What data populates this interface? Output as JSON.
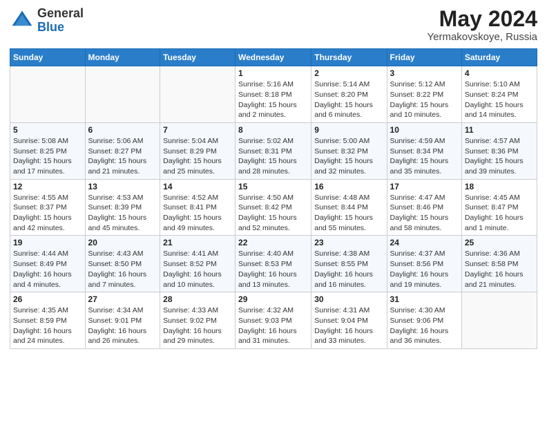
{
  "header": {
    "logo": {
      "general": "General",
      "blue": "Blue"
    },
    "title": "May 2024",
    "location": "Yermakovskoye, Russia"
  },
  "calendar": {
    "days_of_week": [
      "Sunday",
      "Monday",
      "Tuesday",
      "Wednesday",
      "Thursday",
      "Friday",
      "Saturday"
    ],
    "weeks": [
      [
        {
          "day": "",
          "info": ""
        },
        {
          "day": "",
          "info": ""
        },
        {
          "day": "",
          "info": ""
        },
        {
          "day": "1",
          "info": "Sunrise: 5:16 AM\nSunset: 8:18 PM\nDaylight: 15 hours\nand 2 minutes."
        },
        {
          "day": "2",
          "info": "Sunrise: 5:14 AM\nSunset: 8:20 PM\nDaylight: 15 hours\nand 6 minutes."
        },
        {
          "day": "3",
          "info": "Sunrise: 5:12 AM\nSunset: 8:22 PM\nDaylight: 15 hours\nand 10 minutes."
        },
        {
          "day": "4",
          "info": "Sunrise: 5:10 AM\nSunset: 8:24 PM\nDaylight: 15 hours\nand 14 minutes."
        }
      ],
      [
        {
          "day": "5",
          "info": "Sunrise: 5:08 AM\nSunset: 8:25 PM\nDaylight: 15 hours\nand 17 minutes."
        },
        {
          "day": "6",
          "info": "Sunrise: 5:06 AM\nSunset: 8:27 PM\nDaylight: 15 hours\nand 21 minutes."
        },
        {
          "day": "7",
          "info": "Sunrise: 5:04 AM\nSunset: 8:29 PM\nDaylight: 15 hours\nand 25 minutes."
        },
        {
          "day": "8",
          "info": "Sunrise: 5:02 AM\nSunset: 8:31 PM\nDaylight: 15 hours\nand 28 minutes."
        },
        {
          "day": "9",
          "info": "Sunrise: 5:00 AM\nSunset: 8:32 PM\nDaylight: 15 hours\nand 32 minutes."
        },
        {
          "day": "10",
          "info": "Sunrise: 4:59 AM\nSunset: 8:34 PM\nDaylight: 15 hours\nand 35 minutes."
        },
        {
          "day": "11",
          "info": "Sunrise: 4:57 AM\nSunset: 8:36 PM\nDaylight: 15 hours\nand 39 minutes."
        }
      ],
      [
        {
          "day": "12",
          "info": "Sunrise: 4:55 AM\nSunset: 8:37 PM\nDaylight: 15 hours\nand 42 minutes."
        },
        {
          "day": "13",
          "info": "Sunrise: 4:53 AM\nSunset: 8:39 PM\nDaylight: 15 hours\nand 45 minutes."
        },
        {
          "day": "14",
          "info": "Sunrise: 4:52 AM\nSunset: 8:41 PM\nDaylight: 15 hours\nand 49 minutes."
        },
        {
          "day": "15",
          "info": "Sunrise: 4:50 AM\nSunset: 8:42 PM\nDaylight: 15 hours\nand 52 minutes."
        },
        {
          "day": "16",
          "info": "Sunrise: 4:48 AM\nSunset: 8:44 PM\nDaylight: 15 hours\nand 55 minutes."
        },
        {
          "day": "17",
          "info": "Sunrise: 4:47 AM\nSunset: 8:46 PM\nDaylight: 15 hours\nand 58 minutes."
        },
        {
          "day": "18",
          "info": "Sunrise: 4:45 AM\nSunset: 8:47 PM\nDaylight: 16 hours\nand 1 minute."
        }
      ],
      [
        {
          "day": "19",
          "info": "Sunrise: 4:44 AM\nSunset: 8:49 PM\nDaylight: 16 hours\nand 4 minutes."
        },
        {
          "day": "20",
          "info": "Sunrise: 4:43 AM\nSunset: 8:50 PM\nDaylight: 16 hours\nand 7 minutes."
        },
        {
          "day": "21",
          "info": "Sunrise: 4:41 AM\nSunset: 8:52 PM\nDaylight: 16 hours\nand 10 minutes."
        },
        {
          "day": "22",
          "info": "Sunrise: 4:40 AM\nSunset: 8:53 PM\nDaylight: 16 hours\nand 13 minutes."
        },
        {
          "day": "23",
          "info": "Sunrise: 4:38 AM\nSunset: 8:55 PM\nDaylight: 16 hours\nand 16 minutes."
        },
        {
          "day": "24",
          "info": "Sunrise: 4:37 AM\nSunset: 8:56 PM\nDaylight: 16 hours\nand 19 minutes."
        },
        {
          "day": "25",
          "info": "Sunrise: 4:36 AM\nSunset: 8:58 PM\nDaylight: 16 hours\nand 21 minutes."
        }
      ],
      [
        {
          "day": "26",
          "info": "Sunrise: 4:35 AM\nSunset: 8:59 PM\nDaylight: 16 hours\nand 24 minutes."
        },
        {
          "day": "27",
          "info": "Sunrise: 4:34 AM\nSunset: 9:01 PM\nDaylight: 16 hours\nand 26 minutes."
        },
        {
          "day": "28",
          "info": "Sunrise: 4:33 AM\nSunset: 9:02 PM\nDaylight: 16 hours\nand 29 minutes."
        },
        {
          "day": "29",
          "info": "Sunrise: 4:32 AM\nSunset: 9:03 PM\nDaylight: 16 hours\nand 31 minutes."
        },
        {
          "day": "30",
          "info": "Sunrise: 4:31 AM\nSunset: 9:04 PM\nDaylight: 16 hours\nand 33 minutes."
        },
        {
          "day": "31",
          "info": "Sunrise: 4:30 AM\nSunset: 9:06 PM\nDaylight: 16 hours\nand 36 minutes."
        },
        {
          "day": "",
          "info": ""
        }
      ]
    ]
  }
}
